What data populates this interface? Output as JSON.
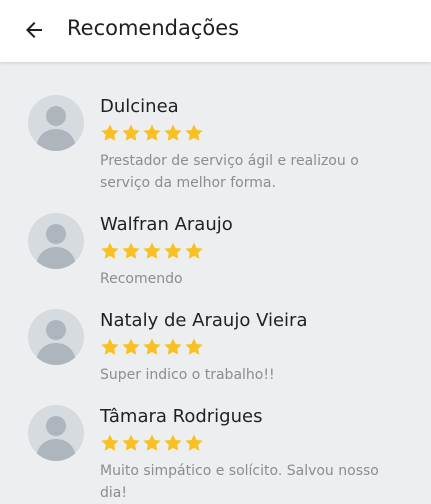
{
  "header": {
    "title": "Recomendações",
    "back_icon": "arrow-left-icon"
  },
  "colors": {
    "star": "#f9c024",
    "background": "#eceef0",
    "app_bar": "#ffffff",
    "comment_text": "#8a8d91"
  },
  "reviews": [
    {
      "name": "Dulcinea",
      "rating": 5,
      "comment": "Prestador de serviço ágil e realizou o serviço da melhor forma.",
      "avatar_icon": "default-user-avatar"
    },
    {
      "name": "Walfran Araujo",
      "rating": 5,
      "comment": "Recomendo",
      "avatar_icon": "default-user-avatar"
    },
    {
      "name": "Nataly de Araujo Vieira",
      "rating": 5,
      "comment": "Super indico o trabalho!!",
      "avatar_icon": "default-user-avatar"
    },
    {
      "name": "Tâmara Rodrigues",
      "rating": 5,
      "comment": "Muito simpático e solícito. Salvou nosso dia!",
      "avatar_icon": "default-user-avatar"
    }
  ]
}
